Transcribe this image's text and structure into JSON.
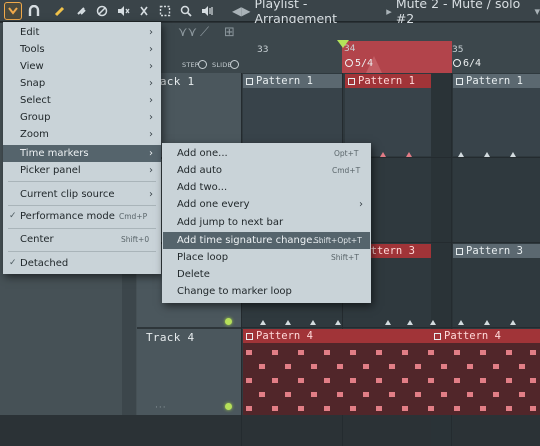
{
  "toolbar": {
    "icons": [
      "menu-arrow-icon",
      "magnet-icon",
      "pencil-icon",
      "paint-icon",
      "delete-icon",
      "mute-icon",
      "slice-icon",
      "select-icon",
      "zoom-icon",
      "playback-icon"
    ],
    "title": "Playlist - Arrangement",
    "mute_label": "Mute 2 - Mute / solo #2"
  },
  "ruler": {
    "step_label": "STEP",
    "slide_label": "SLIDE",
    "bars": [
      "33",
      "34",
      "35"
    ],
    "time_sig_1": "5/4",
    "time_sig_2": "6/4"
  },
  "tracks": [
    {
      "name": "Track 1"
    },
    {
      "name": "Track 4"
    }
  ],
  "clips": {
    "pattern1": "Pattern 1",
    "pattern3": "Pattern 3",
    "pattern4": "Pattern 4"
  },
  "main_menu": {
    "items": [
      {
        "label": "Edit",
        "submenu": true
      },
      {
        "label": "Tools",
        "submenu": true
      },
      {
        "label": "View",
        "submenu": true
      },
      {
        "label": "Snap",
        "submenu": true
      },
      {
        "label": "Select",
        "submenu": true
      },
      {
        "label": "Group",
        "submenu": true
      },
      {
        "label": "Zoom",
        "submenu": true
      },
      {
        "label": "Time markers",
        "submenu": true,
        "highlighted": true
      },
      {
        "label": "Picker panel",
        "submenu": true
      },
      {
        "label": "Current clip source",
        "submenu": true
      },
      {
        "label": "Performance mode",
        "shortcut": "Cmd+P",
        "checked": true
      },
      {
        "label": "Center",
        "shortcut": "Shift+0"
      },
      {
        "label": "Detached",
        "checked": true
      }
    ]
  },
  "time_markers_menu": {
    "items": [
      {
        "label": "Add one...",
        "shortcut": "Opt+T"
      },
      {
        "label": "Add auto",
        "shortcut": "Cmd+T"
      },
      {
        "label": "Add two..."
      },
      {
        "label": "Add one every",
        "submenu": true
      },
      {
        "label": "Add jump to next bar"
      },
      {
        "label": "Add time signature change...",
        "shortcut": "Shift+Opt+T",
        "highlighted": true
      },
      {
        "label": "Place loop",
        "shortcut": "Shift+T"
      },
      {
        "label": "Delete"
      },
      {
        "label": "Change to marker loop"
      }
    ]
  },
  "colors": {
    "accent_red": "#a13438",
    "menu_bg": "#c9d3d8",
    "menu_highlight": "#55646c",
    "led_green": "#b6e05a",
    "toolbar_active": "#f0a94a"
  }
}
